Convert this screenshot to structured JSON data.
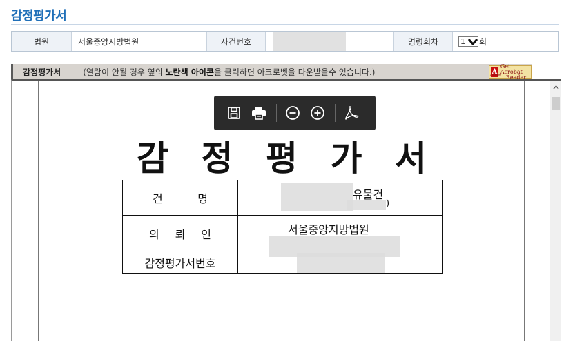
{
  "page": {
    "title": "감정평가서"
  },
  "info": {
    "court_label": "법원",
    "court_value": "서울중앙지방법원",
    "case_label": "사건번호",
    "case_value": "",
    "order_label": "명령회차",
    "order_selected": "1",
    "order_suffix": "회"
  },
  "doc_bar": {
    "title": "감정평가서",
    "note_prefix": "(열람이 안될 경우 옆의 ",
    "note_bold": "노란색 아이콘",
    "note_suffix": "을 클릭하면 아크로벳을 다운받을수 있습니다.)",
    "badge_logo": "A",
    "badge_line1": "Get Acrobat",
    "badge_line2": "Reader",
    "badge_vendor": "Adobe"
  },
  "toolbar": {
    "icons": [
      "save-icon",
      "print-icon",
      "zoom-out-icon",
      "zoom-in-icon",
      "acrobat-icon"
    ]
  },
  "document": {
    "heading_chars": [
      "감",
      "정",
      "평",
      "가",
      "서"
    ],
    "rows": [
      {
        "key_chars": [
          "건",
          "명"
        ],
        "value_line1": "유물건",
        "value_line2": ")"
      },
      {
        "key_chars": [
          "의",
          "뢰",
          "인"
        ],
        "value_line1": "서울중앙지방법원",
        "value_line2": ""
      },
      {
        "key": "감정평가서번호",
        "value_line1": "",
        "value_line2": ""
      }
    ]
  },
  "colors": {
    "title_blue": "#1f6fb8",
    "toolbar_bg": "#2b2b2b",
    "label_bg": "#eef2f7",
    "bar_bg": "#d8d4cf"
  }
}
